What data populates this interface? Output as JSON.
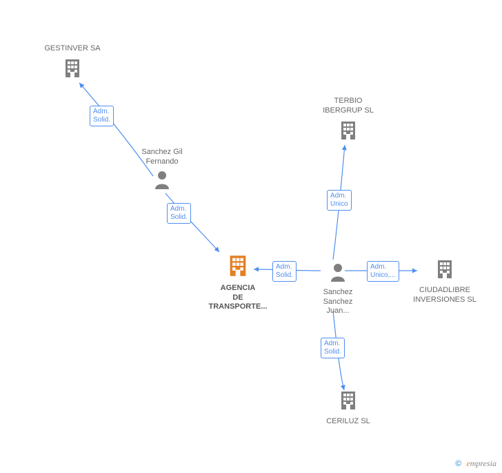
{
  "diagram": {
    "nodes": {
      "gestinver": {
        "type": "company",
        "label": "GESTINVER SA"
      },
      "terbio": {
        "type": "company",
        "label": "TERBIO\nIBERGRUP SL"
      },
      "ciudadlibre": {
        "type": "company",
        "label": "CIUDADLIBRE\nINVERSIONES SL"
      },
      "ceriluz": {
        "type": "company",
        "label": "CERILUZ SL"
      },
      "agencia": {
        "type": "company_focus",
        "label": "AGENCIA\nDE\nTRANSPORTE..."
      },
      "sanchez_gil": {
        "type": "person",
        "label": "Sanchez Gil\nFernando"
      },
      "sanchez_sanchez": {
        "type": "person",
        "label": "Sanchez\nSanchez\nJuan..."
      }
    },
    "edges": {
      "e1": {
        "from": "sanchez_gil",
        "to": "gestinver",
        "label": "Adm.\nSolid."
      },
      "e2": {
        "from": "sanchez_gil",
        "to": "agencia",
        "label": "Adm.\nSolid."
      },
      "e3": {
        "from": "sanchez_sanchez",
        "to": "agencia",
        "label": "Adm.\nSolid."
      },
      "e4": {
        "from": "sanchez_sanchez",
        "to": "terbio",
        "label": "Adm.\nUnico"
      },
      "e5": {
        "from": "sanchez_sanchez",
        "to": "ciudadlibre",
        "label": "Adm.\nUnico,..."
      },
      "e6": {
        "from": "sanchez_sanchez",
        "to": "ceriluz",
        "label": "Adm.\nSolid."
      }
    }
  },
  "footer": {
    "copyright_symbol": "©",
    "brand_first_letter": "e",
    "brand_rest": "mpresia"
  }
}
